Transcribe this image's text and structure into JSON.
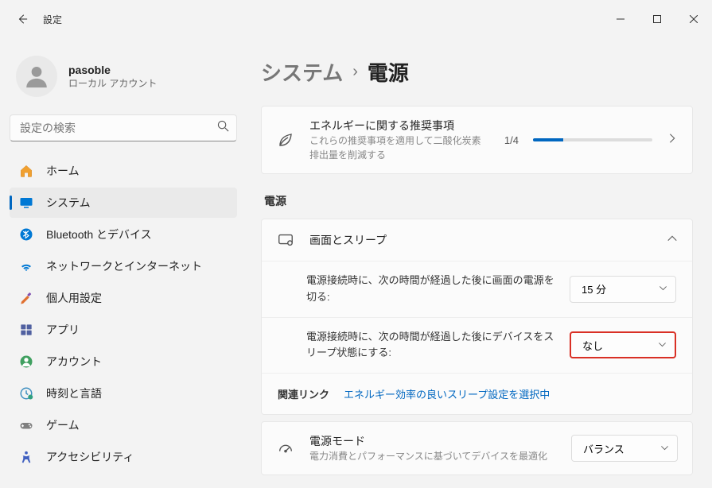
{
  "app_title": "設定",
  "user": {
    "name": "pasoble",
    "subtitle": "ローカル アカウント"
  },
  "search": {
    "placeholder": "設定の検索"
  },
  "nav": {
    "items": [
      {
        "label": "ホーム",
        "icon": "home"
      },
      {
        "label": "システム",
        "icon": "system",
        "active": true
      },
      {
        "label": "Bluetooth とデバイス",
        "icon": "bluetooth"
      },
      {
        "label": "ネットワークとインターネット",
        "icon": "wifi"
      },
      {
        "label": "個人用設定",
        "icon": "brush"
      },
      {
        "label": "アプリ",
        "icon": "apps"
      },
      {
        "label": "アカウント",
        "icon": "account"
      },
      {
        "label": "時刻と言語",
        "icon": "clock"
      },
      {
        "label": "ゲーム",
        "icon": "game"
      },
      {
        "label": "アクセシビリティ",
        "icon": "access"
      }
    ]
  },
  "breadcrumb": {
    "root": "システム",
    "current": "電源"
  },
  "energy_card": {
    "title": "エネルギーに関する推奨事項",
    "subtitle": "これらの推奨事項を適用して二酸化炭素排出量を削減する",
    "progress_text": "1/4",
    "progress_fraction": 0.25
  },
  "section_header": "電源",
  "screen_sleep": {
    "header": "画面とスリープ",
    "row1": {
      "label": "電源接続時に、次の時間が経過した後に画面の電源を切る:",
      "value": "15 分"
    },
    "row2": {
      "label": "電源接続時に、次の時間が経過した後にデバイスをスリープ状態にする:",
      "value": "なし",
      "highlight": true
    }
  },
  "related": {
    "label": "関連リンク",
    "link": "エネルギー効率の良いスリープ設定を選択中"
  },
  "power_mode": {
    "title": "電源モード",
    "subtitle": "電力消費とパフォーマンスに基づいてデバイスを最適化",
    "value": "バランス"
  }
}
